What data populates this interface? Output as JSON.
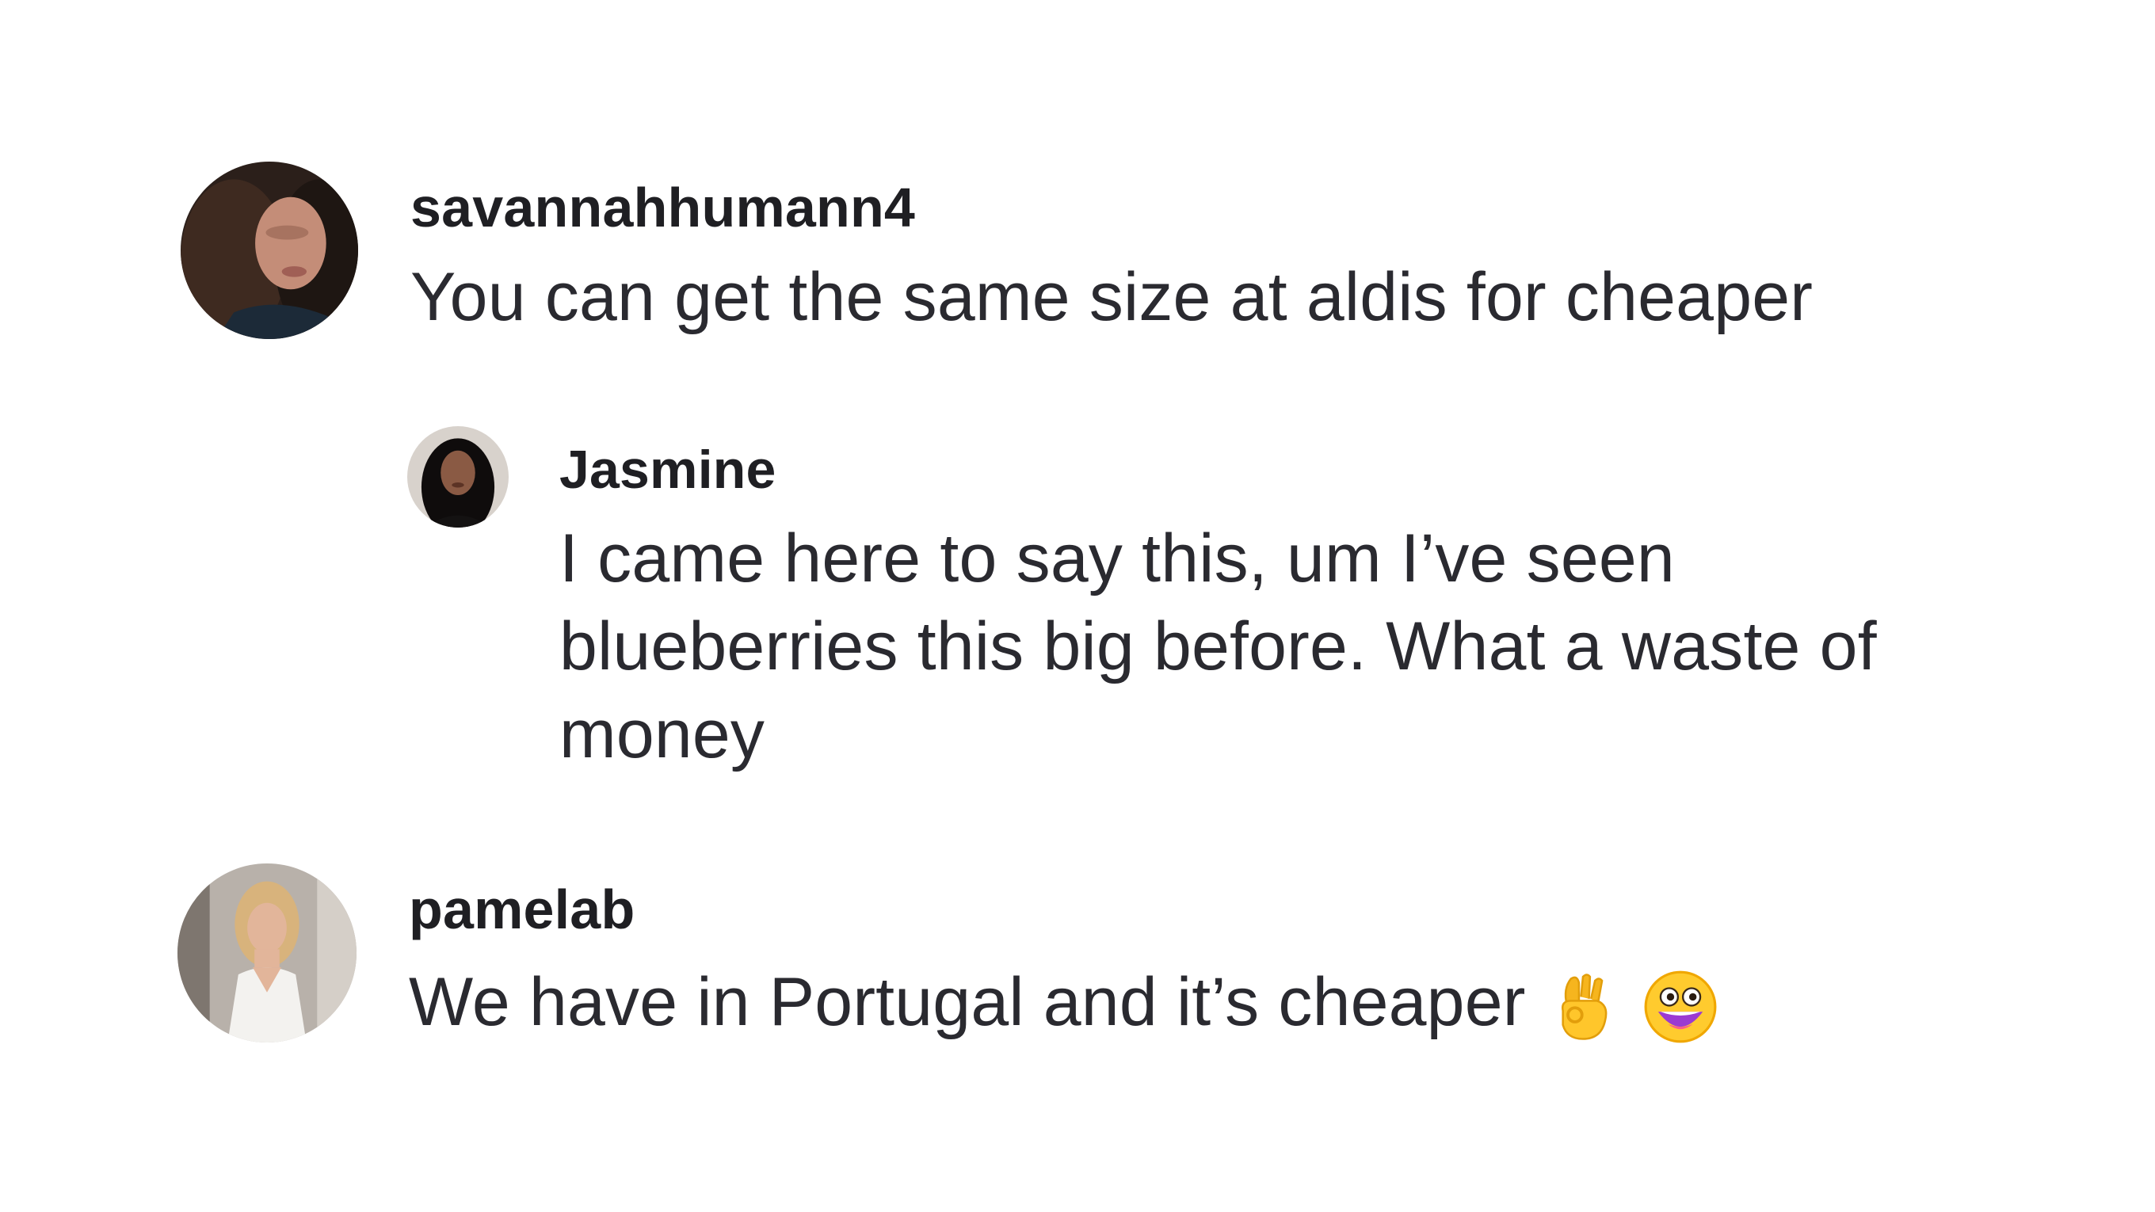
{
  "comments": [
    {
      "username": "savannahhumann4",
      "text": "You can get the same size at aldis for cheaper",
      "avatar_icon": "user-avatar-dark-hair"
    },
    {
      "username": "Jasmine",
      "text_lines": [
        "I came here to say this, um I’ve seen",
        "blueberries this big before. What a waste of",
        "money"
      ],
      "avatar_icon": "user-avatar-black-hair",
      "is_reply": true
    },
    {
      "username": "pamelab",
      "text": "We have in Portugal and it’s cheaper",
      "emojis": [
        "ok-hand-emoji",
        "grinning-face-emoji"
      ],
      "avatar_icon": "user-avatar-blonde-white-dress"
    }
  ],
  "colors": {
    "username": "#1f1f23",
    "text": "#2a2a30",
    "background": "#ffffff"
  }
}
